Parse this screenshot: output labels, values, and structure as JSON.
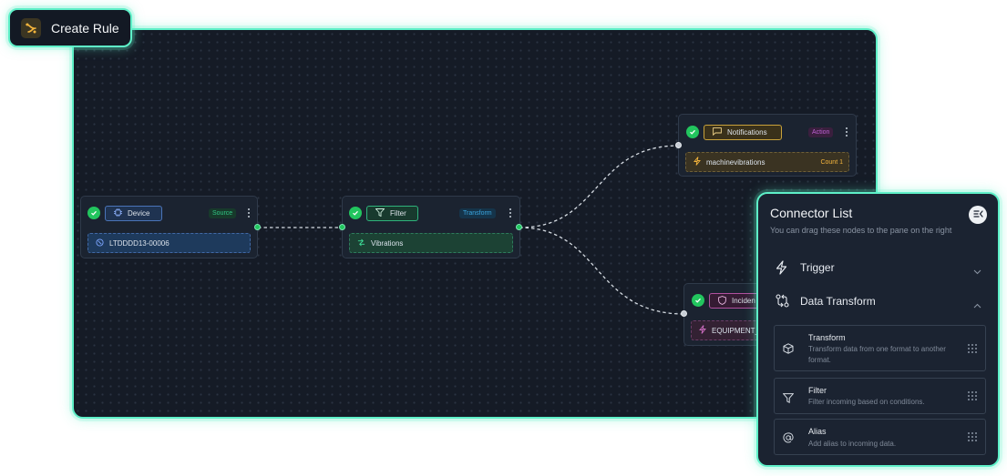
{
  "header": {
    "title": "Create Rule",
    "logo_icon": "workflow-logo-icon"
  },
  "colors": {
    "accent": "#5ef0c8",
    "success": "#22c55e",
    "canvas": "#151b26",
    "node": "#1b2330"
  },
  "nodes": {
    "device": {
      "label": "Device",
      "tag": "Source",
      "body": "LTDDDD13-00006",
      "icon": "chip-icon",
      "body_icon": "device-icon"
    },
    "filter": {
      "label": "Filter",
      "tag": "Transform",
      "body": "Vibrations",
      "icon": "filter-icon",
      "body_icon": "transform-icon"
    },
    "notifications": {
      "label": "Notifications",
      "tag": "Action",
      "body": "machinevibrations",
      "count": "Count 1",
      "icon": "message-icon",
      "body_icon": "lightning-icon"
    },
    "incident": {
      "label": "Inciden",
      "body": "EQUIPMENT_",
      "icon": "shield-icon",
      "body_icon": "lightning-icon"
    }
  },
  "connector_panel": {
    "title": "Connector List",
    "subtitle": "You can drag these nodes to the pane on the right",
    "sections": [
      {
        "label": "Trigger",
        "icon": "lightning-icon",
        "expanded": false
      },
      {
        "label": "Data Transform",
        "icon": "git-compare-icon",
        "expanded": true
      }
    ],
    "items": [
      {
        "title": "Transform",
        "description": "Transform data from one format to another format.",
        "icon": "package-icon"
      },
      {
        "title": "Filter",
        "description": "Filter incoming based on conditions.",
        "icon": "filter-icon"
      },
      {
        "title": "Alias",
        "description": "Add alias to incoming data.",
        "icon": "at-sign-icon"
      }
    ]
  }
}
